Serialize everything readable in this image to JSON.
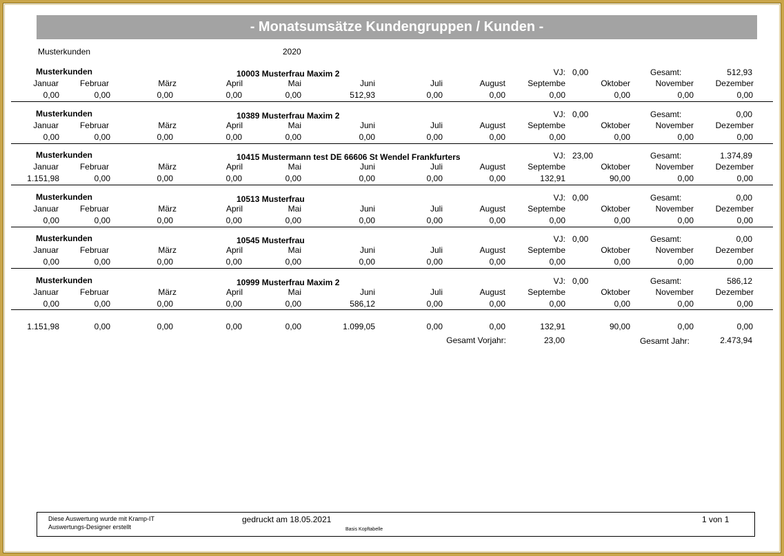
{
  "title": "- Monatsumsätze Kundengruppen / Kunden -",
  "header": {
    "group": "Musterkunden",
    "year": "2020"
  },
  "months": [
    "Januar",
    "Februar",
    "März",
    "April",
    "Mai",
    "Juni",
    "Juli",
    "August",
    "Septembe",
    "Oktober",
    "November",
    "Dezember"
  ],
  "labels": {
    "vj": "VJ:",
    "gesamt": "Gesamt:",
    "gesamt_vorjahr": "Gesamt Vorjahr:",
    "gesamt_jahr": "Gesamt Jahr:"
  },
  "customers": [
    {
      "group": "Musterkunden",
      "name": "10003  Musterfrau Maxim 2",
      "vj": "0,00",
      "gesamt": "512,93",
      "values": [
        "0,00",
        "0,00",
        "0,00",
        "0,00",
        "0,00",
        "512,93",
        "0,00",
        "0,00",
        "0,00",
        "0,00",
        "0,00",
        "0,00"
      ]
    },
    {
      "group": "Musterkunden",
      "name": "10389  Musterfrau Maxim 2",
      "vj": "0,00",
      "gesamt": "0,00",
      "values": [
        "0,00",
        "0,00",
        "0,00",
        "0,00",
        "0,00",
        "0,00",
        "0,00",
        "0,00",
        "0,00",
        "0,00",
        "0,00",
        "0,00"
      ]
    },
    {
      "group": "Musterkunden",
      "name": "10415  Mustermann test  DE 66606  St Wendel  Frankfurters",
      "vj": "23,00",
      "gesamt": "1.374,89",
      "values": [
        "1.151,98",
        "0,00",
        "0,00",
        "0,00",
        "0,00",
        "0,00",
        "0,00",
        "0,00",
        "132,91",
        "90,00",
        "0,00",
        "0,00"
      ]
    },
    {
      "group": "Musterkunden",
      "name": "10513  Musterfrau",
      "vj": "0,00",
      "gesamt": "0,00",
      "values": [
        "0,00",
        "0,00",
        "0,00",
        "0,00",
        "0,00",
        "0,00",
        "0,00",
        "0,00",
        "0,00",
        "0,00",
        "0,00",
        "0,00"
      ]
    },
    {
      "group": "Musterkunden",
      "name": "10545  Musterfrau",
      "vj": "0,00",
      "gesamt": "0,00",
      "values": [
        "0,00",
        "0,00",
        "0,00",
        "0,00",
        "0,00",
        "0,00",
        "0,00",
        "0,00",
        "0,00",
        "0,00",
        "0,00",
        "0,00"
      ]
    },
    {
      "group": "Musterkunden",
      "name": "10999  Musterfrau Maxim 2",
      "vj": "0,00",
      "gesamt": "586,12",
      "values": [
        "0,00",
        "0,00",
        "0,00",
        "0,00",
        "0,00",
        "586,12",
        "0,00",
        "0,00",
        "0,00",
        "0,00",
        "0,00",
        "0,00"
      ]
    }
  ],
  "totals": {
    "values": [
      "1.151,98",
      "0,00",
      "0,00",
      "0,00",
      "0,00",
      "1.099,05",
      "0,00",
      "0,00",
      "132,91",
      "90,00",
      "0,00",
      "0,00"
    ],
    "gesamt_vorjahr": "23,00",
    "gesamt_jahr": "2.473,94"
  },
  "footer": {
    "created_line1": "Diese Auswertung wurde mit Kramp-IT",
    "created_line2": "Auswertungs-Designer erstellt",
    "printed": "gedruckt  am 18.05.2021",
    "basis": "Basis Kopftabelle",
    "page": "1 von 1"
  }
}
